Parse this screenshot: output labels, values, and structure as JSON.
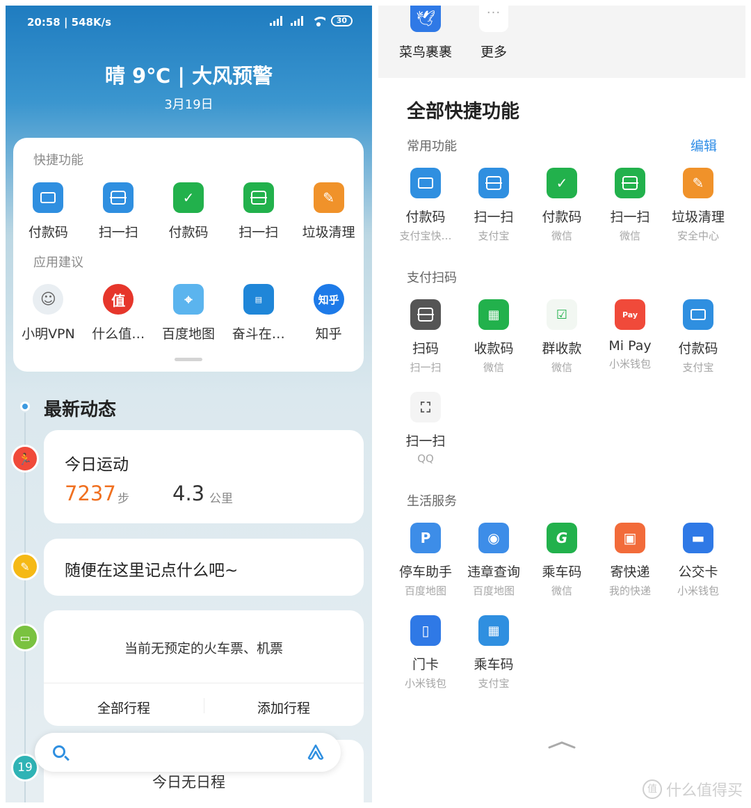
{
  "colors": {
    "blue": "#2f8fe0",
    "green": "#22b14c",
    "orange": "#f0922a",
    "red": "#f04a3a",
    "steps_orange": "#f07020",
    "link_blue": "#2e8ce6"
  },
  "left": {
    "status": {
      "time": "20:58 | 548K/s",
      "battery": "30"
    },
    "weather": {
      "title": "晴 9℃ | 大风预警",
      "date": "3月19日"
    },
    "quick": {
      "section_label": "快捷功能",
      "items": [
        {
          "label": "付款码",
          "icon": "barcode-icon"
        },
        {
          "label": "扫一扫",
          "icon": "scan-icon"
        },
        {
          "label": "付款码",
          "icon": "barcode-check-icon"
        },
        {
          "label": "扫一扫",
          "icon": "scan-icon"
        },
        {
          "label": "垃圾清理",
          "icon": "broom-icon"
        }
      ]
    },
    "apps": {
      "section_label": "应用建议",
      "items": [
        {
          "label": "小明VPN",
          "icon": "avatar-icon"
        },
        {
          "label": "什么值…",
          "icon": "zhi-icon",
          "glyph": "值"
        },
        {
          "label": "百度地图",
          "icon": "map-icon"
        },
        {
          "label": "奋斗在…",
          "icon": "newspaper-icon"
        },
        {
          "label": "知乎",
          "icon": "zhihu-icon",
          "glyph": "知乎"
        }
      ]
    },
    "news": {
      "title": "最新动态"
    },
    "sport": {
      "title": "今日运动",
      "steps": "7237",
      "steps_unit": "步",
      "km": "4.3",
      "km_unit": "公里"
    },
    "note": {
      "placeholder": "随便在这里记点什么吧~"
    },
    "trip": {
      "empty_text": "当前无预定的火车票、机票",
      "all_label": "全部行程",
      "add_label": "添加行程"
    },
    "calendar": {
      "day": "19",
      "empty_text": "今日无日程"
    }
  },
  "right": {
    "strip": [
      {
        "label": "菜鸟裹裹",
        "icon": "cainiao-icon"
      },
      {
        "label": "更多",
        "icon": "more-icon"
      }
    ],
    "title": "全部快捷功能",
    "common": {
      "label": "常用功能",
      "edit": "编辑",
      "items": [
        {
          "label": "付款码",
          "sub": "支付宝快…",
          "icon": "barcode-icon"
        },
        {
          "label": "扫一扫",
          "sub": "支付宝",
          "icon": "scan-icon"
        },
        {
          "label": "付款码",
          "sub": "微信",
          "icon": "barcode-check-icon"
        },
        {
          "label": "扫一扫",
          "sub": "微信",
          "icon": "scan-icon"
        },
        {
          "label": "垃圾清理",
          "sub": "安全中心",
          "icon": "broom-icon"
        }
      ]
    },
    "pay": {
      "label": "支付扫码",
      "items": [
        {
          "label": "扫码",
          "sub": "扫一扫",
          "icon": "scan-icon"
        },
        {
          "label": "收款码",
          "sub": "微信",
          "icon": "qrcode-icon"
        },
        {
          "label": "群收款",
          "sub": "微信",
          "icon": "group-collect-icon"
        },
        {
          "label": "Mi Pay",
          "sub": "小米钱包",
          "icon": "mipay-icon",
          "glyph": "Pay"
        },
        {
          "label": "付款码",
          "sub": "支付宝",
          "icon": "barcode-icon"
        },
        {
          "label": "扫一扫",
          "sub": "QQ",
          "icon": "scan-frame-icon"
        }
      ]
    },
    "life": {
      "label": "生活服务",
      "items": [
        {
          "label": "停车助手",
          "sub": "百度地图",
          "icon": "parking-icon",
          "glyph": "P"
        },
        {
          "label": "违章查询",
          "sub": "百度地图",
          "icon": "violation-icon"
        },
        {
          "label": "乘车码",
          "sub": "微信",
          "icon": "ride-code-icon",
          "glyph": "G"
        },
        {
          "label": "寄快递",
          "sub": "我的快递",
          "icon": "package-icon"
        },
        {
          "label": "公交卡",
          "sub": "小米钱包",
          "icon": "bus-icon"
        },
        {
          "label": "门卡",
          "sub": "小米钱包",
          "icon": "door-icon"
        },
        {
          "label": "乘车码",
          "sub": "支付宝",
          "icon": "ride-qr-icon"
        }
      ]
    }
  },
  "watermark": {
    "text": "什么值得买",
    "glyph": "值"
  }
}
